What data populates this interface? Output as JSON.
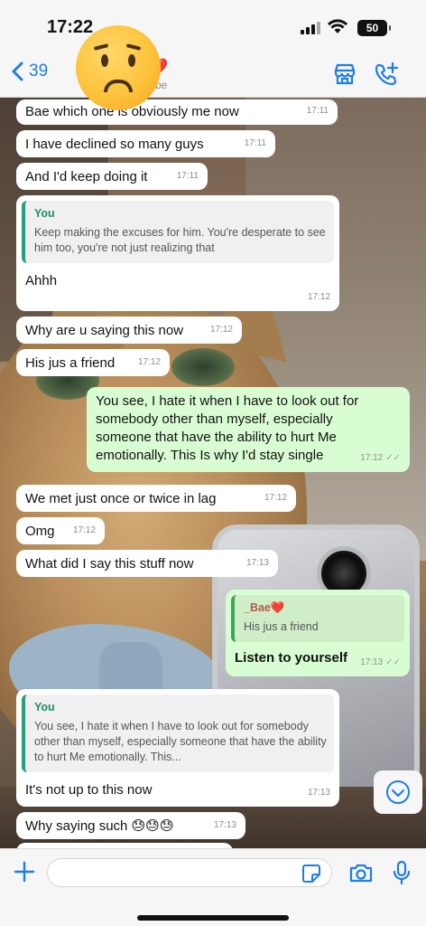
{
  "status_bar": {
    "time": "17:22",
    "battery": "50"
  },
  "header": {
    "back_count": "39",
    "contact_name": "❤️",
    "contact_sub": "be"
  },
  "messages": [
    {
      "dir": "in",
      "text": "Bae which one is obviously me now",
      "time": "17:11"
    },
    {
      "dir": "in",
      "text": "I have declined so many guys",
      "time": "17:11"
    },
    {
      "dir": "in",
      "text": "And I'd keep doing it",
      "time": "17:11"
    },
    {
      "dir": "in",
      "quote_author": "You",
      "quote_text": "Keep making the excuses for him. You're desperate to see him too, you're not just realizing that",
      "text": "Ahhh",
      "time": "17:12"
    },
    {
      "dir": "in",
      "text": "Why are u saying this now",
      "time": "17:12"
    },
    {
      "dir": "in",
      "text": "His jus a friend",
      "time": "17:12"
    },
    {
      "dir": "out",
      "text": "You see, I hate it when I have to look out for somebody other than myself, especially someone that have the ability to hurt Me emotionally. This Is why I'd stay single",
      "time": "17:12"
    },
    {
      "dir": "in",
      "text": "We met just once or twice in lag",
      "time": "17:12"
    },
    {
      "dir": "in",
      "text": "Omg",
      "time": "17:12"
    },
    {
      "dir": "in",
      "text": "What did I say this stuff now",
      "time": "17:13"
    },
    {
      "dir": "out",
      "quote_author": "_Bae❤️",
      "quote_text": "His jus a friend",
      "text": "Listen to yourself",
      "time": "17:13"
    },
    {
      "dir": "in",
      "quote_author": "You",
      "quote_text": "You see, I hate it when I have to look out for somebody other than myself, especially someone that have the ability to hurt Me emotionally. This...",
      "text": "It's not up to this now",
      "time": "17:13"
    },
    {
      "dir": "in",
      "text": "Why saying such 😓😓😓",
      "time": "17:13"
    }
  ],
  "icons": [
    "back-chevron-icon",
    "store-icon",
    "add-call-icon",
    "scroll-down-icon",
    "plus-icon",
    "sticker-icon",
    "camera-icon",
    "microphone-icon"
  ],
  "colors": {
    "accent": "#1e7ee8",
    "incoming": "#ffffff",
    "outgoing": "#d9fdd3",
    "quote_bar": "#25a07a"
  }
}
